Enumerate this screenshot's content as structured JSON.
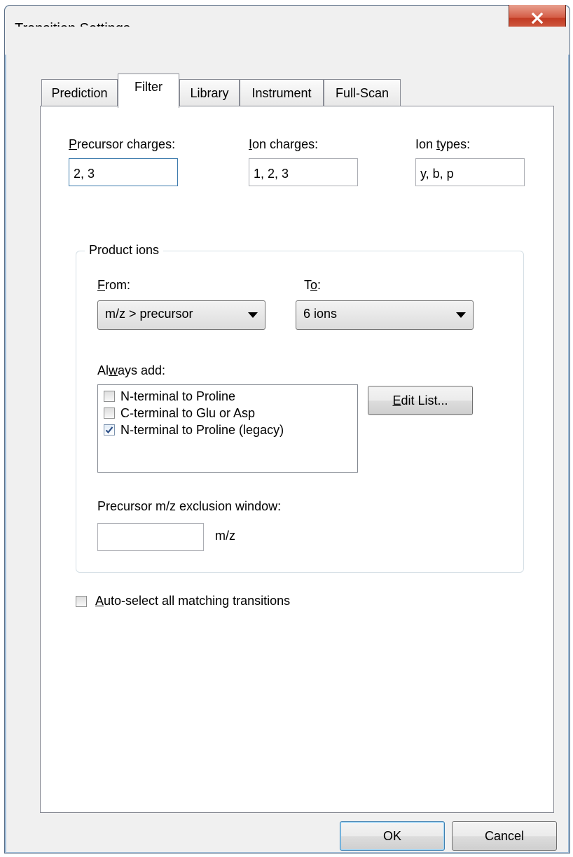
{
  "window": {
    "title": "Transition Settings"
  },
  "tabs": [
    {
      "label": "Prediction"
    },
    {
      "label": "Filter"
    },
    {
      "label": "Library"
    },
    {
      "label": "Instrument"
    },
    {
      "label": "Full-Scan"
    }
  ],
  "filter": {
    "precursor_charges": {
      "label_u": "P",
      "label_rest": "recursor charges:",
      "value": "2, 3"
    },
    "ion_charges": {
      "label_u": "I",
      "label_rest": "on charges:",
      "value": "1, 2, 3"
    },
    "ion_types": {
      "label_pre": "Ion ",
      "label_u": "t",
      "label_rest": "ypes:",
      "value": "y, b, p"
    },
    "product_ions": {
      "title": "Product ions",
      "from": {
        "label_u": "F",
        "label_rest": "rom:",
        "value": "m/z > precursor"
      },
      "to": {
        "label_pre": "T",
        "label_u": "o",
        "label_rest": ":",
        "value": "6 ions"
      },
      "always_add": {
        "label_pre": "Al",
        "label_u": "w",
        "label_rest": "ays add:",
        "items": [
          {
            "label": "N-terminal to Proline",
            "checked": false
          },
          {
            "label": "C-terminal to Glu or Asp",
            "checked": false
          },
          {
            "label": "N-terminal to Proline (legacy)",
            "checked": true
          }
        ],
        "edit_button": {
          "label_u": "E",
          "label_rest": "dit List..."
        }
      },
      "exclusion": {
        "label": "Precursor m/z exclusion window:",
        "value": "",
        "unit": "m/z"
      }
    },
    "auto_select": {
      "label_u": "A",
      "label_rest": "uto-select all matching transitions",
      "checked": false
    }
  },
  "buttons": {
    "ok": "OK",
    "cancel": "Cancel"
  }
}
